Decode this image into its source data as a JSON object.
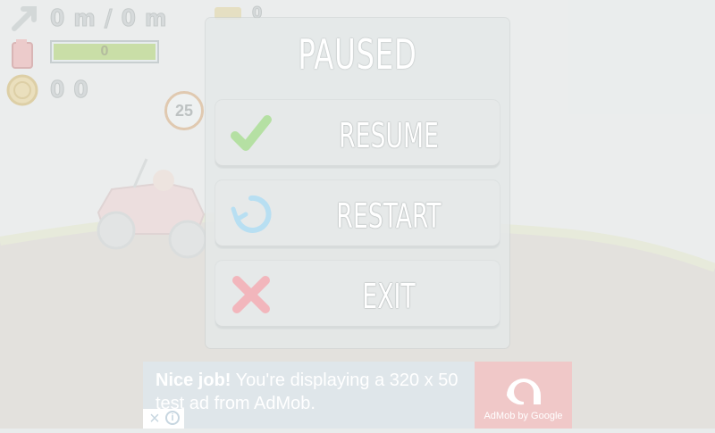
{
  "hud": {
    "distance_text": "0 m / 0 m",
    "coins_text": "0 0",
    "fuel_label": "0",
    "fuel_percent": 100,
    "speed_badge": "25",
    "top_indicator": "0"
  },
  "pause_menu": {
    "title": "PAUSED",
    "resume_label": "RESUME",
    "restart_label": "RESTART",
    "exit_label": "EXIT"
  },
  "ad": {
    "headline": "Nice job!",
    "body": "You're displaying a 320 x 50 test ad from AdMob.",
    "brand": "AdMob by Google"
  },
  "colors": {
    "resume_icon": "#b5e0a3",
    "restart_icon": "#b8dff2",
    "exit_icon": "#f2b6bc",
    "ad_accent": "#f0c8c8"
  }
}
